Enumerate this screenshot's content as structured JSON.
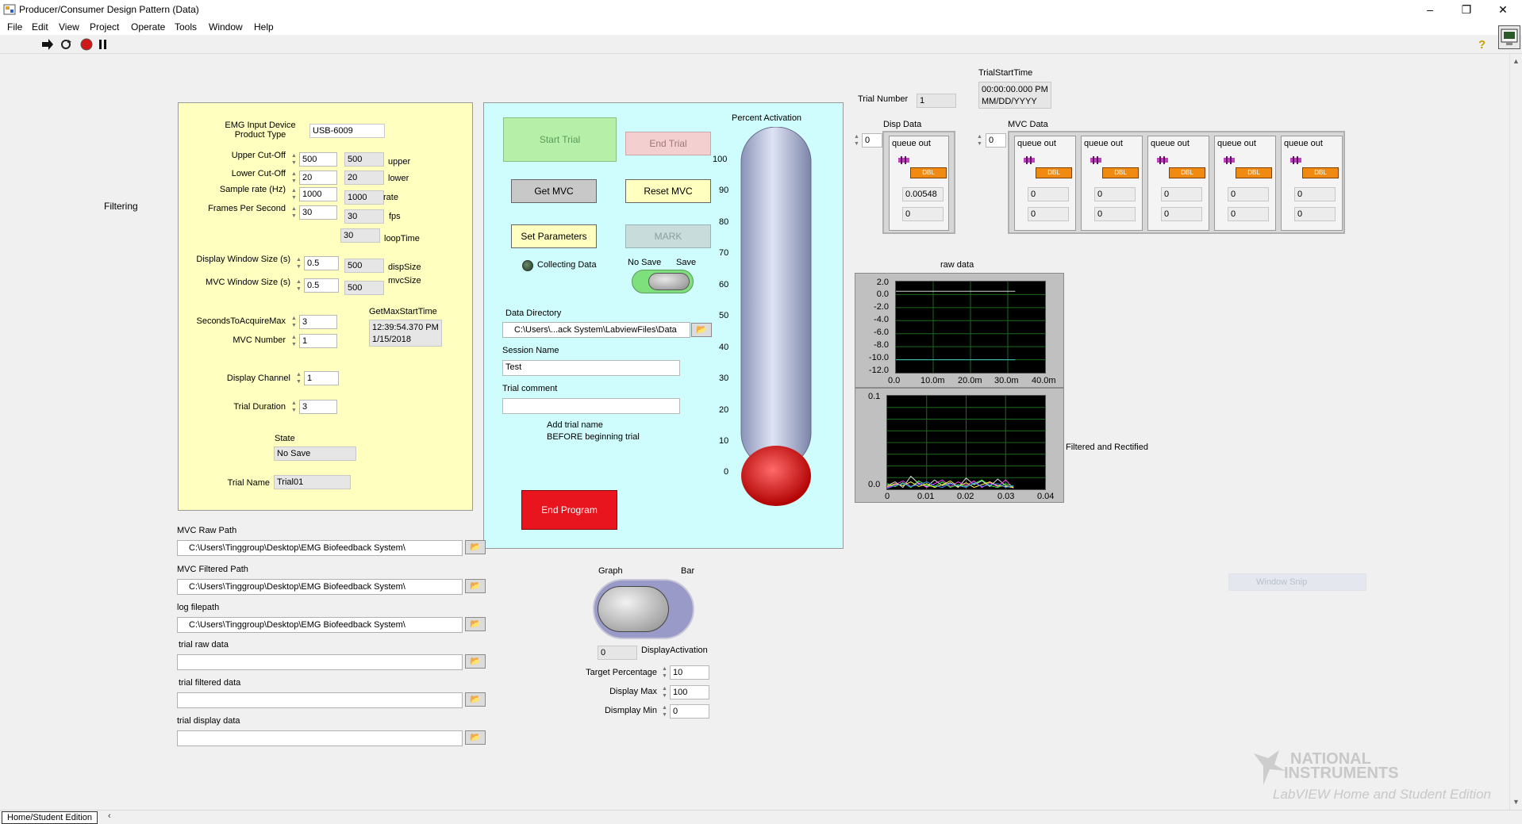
{
  "window": {
    "title": "Producer/Consumer Design Pattern (Data)",
    "minimize": "–",
    "restore": "❐",
    "close": "✕"
  },
  "menu": [
    "File",
    "Edit",
    "View",
    "Project",
    "Operate",
    "Tools",
    "Window",
    "Help"
  ],
  "side_label": "Filtering",
  "settings": {
    "emg_device_label": "EMG Input Device\nProduct Type",
    "emg_device_value": "USB-6009",
    "upper_label": "Upper Cut-Off",
    "upper_value": "500",
    "upper_ind": "500",
    "upper_unit": "upper",
    "lower_label": "Lower Cut-Off",
    "lower_value": "20",
    "lower_ind": "20",
    "lower_unit": "lower",
    "rate_label": "Sample rate (Hz)",
    "rate_value": "1000",
    "rate_ind": "1000",
    "rate_unit": "rate",
    "fps_label": "Frames Per Second",
    "fps_value": "30",
    "fps_ind": "30",
    "fps_unit": "fps",
    "loop_ind": "30",
    "loop_unit": "loopTime",
    "disp_label": "Display Window Size (s)",
    "disp_value": "0.5",
    "disp_ind": "500",
    "disp_unit": "dispSize",
    "mvcwin_label": "MVC Window Size (s)",
    "mvcwin_value": "0.5",
    "mvcwin_ind": "500",
    "mvcwin_unit": "mvcSize",
    "secs_label": "SecondsToAcquireMax",
    "secs_value": "3",
    "mvcnum_label": "MVC Number",
    "mvcnum_value": "1",
    "getmax_label": "GetMaxStartTime",
    "getmax_time": "12:39:54.370 PM",
    "getmax_date": "1/15/2018",
    "channel_label": "Display Channel",
    "channel_value": "1",
    "duration_label": "Trial Duration",
    "duration_value": "3",
    "state_label": "State",
    "state_value": "No Save",
    "trialname_label": "Trial Name",
    "trialname_value": "Trial01"
  },
  "control": {
    "start_trial": "Start Trial",
    "end_trial": "End Trial",
    "get_mvc": "Get MVC",
    "reset_mvc": "Reset MVC",
    "set_params": "Set Parameters",
    "mark": "MARK",
    "collecting": "Collecting Data",
    "no_save": "No Save",
    "save": "Save",
    "data_dir_label": "Data Directory",
    "data_dir_value": "C:\\Users\\...ack System\\LabviewFiles\\Data",
    "session_label": "Session Name",
    "session_value": "Test",
    "comment_label": "Trial comment",
    "comment_value": "",
    "hint_line1": "Add trial name",
    "hint_line2": "BEFORE beginning trial",
    "end_program": "End Program",
    "activation_label": "Percent Activation",
    "activation_ticks": [
      "100",
      "90",
      "80",
      "70",
      "60",
      "50",
      "40",
      "30",
      "20",
      "10",
      "0"
    ],
    "activation_value": 0
  },
  "paths": [
    {
      "label": "MVC Raw Path",
      "value": "C:\\Users\\Tinggroup\\Desktop\\EMG Biofeedback System\\"
    },
    {
      "label": "MVC Filtered Path",
      "value": "C:\\Users\\Tinggroup\\Desktop\\EMG Biofeedback System\\"
    },
    {
      "label": "log filepath",
      "value": "C:\\Users\\Tinggroup\\Desktop\\EMG Biofeedback System\\"
    },
    {
      "label": "trial raw data",
      "value": ""
    },
    {
      "label": "trial filtered data",
      "value": ""
    },
    {
      "label": "trial display data",
      "value": ""
    }
  ],
  "display_mode": {
    "graph": "Graph",
    "bar": "Bar",
    "activation_value": "0",
    "activation_label": "DisplayActivation",
    "target_label": "Target Percentage",
    "target_value": "10",
    "max_label": "Display Max",
    "max_value": "100",
    "min_label": "Dismplay Min",
    "min_value": "0"
  },
  "trial": {
    "number_label": "Trial Number",
    "number_value": "1",
    "start_label": "TrialStartTime",
    "start_time": "00:00:00.000 PM",
    "start_date": "MM/DD/YYYY"
  },
  "disp_data": {
    "label": "Disp Data",
    "index": "0",
    "queue_label": "queue out",
    "dbl": "DBL",
    "v1": "0.00548",
    "v2": "0"
  },
  "mvc_data": {
    "label": "MVC Data",
    "index": "0",
    "queues": [
      {
        "label": "queue out",
        "v1": "0",
        "v2": "0"
      },
      {
        "label": "queue out",
        "v1": "0",
        "v2": "0"
      },
      {
        "label": "queue out",
        "v1": "0",
        "v2": "0"
      },
      {
        "label": "queue out",
        "v1": "0",
        "v2": "0"
      },
      {
        "label": "queue out",
        "v1": "0",
        "v2": "0"
      }
    ]
  },
  "raw_chart": {
    "title": "raw data",
    "yticks": [
      "2.0",
      "0.0",
      "-2.0",
      "-4.0",
      "-6.0",
      "-8.0",
      "-10.0",
      "-12.0"
    ],
    "xticks": [
      "0.0",
      "10.0m",
      "20.0m",
      "30.0m",
      "40.0m"
    ]
  },
  "filtered_chart": {
    "title": "Filtered and Rectified",
    "yticks": [
      "0.1",
      "0.0"
    ],
    "xticks": [
      "0",
      "0.01",
      "0.02",
      "0.03",
      "0.04"
    ]
  },
  "chart_data": [
    {
      "type": "line",
      "title": "raw data",
      "xlim": [
        0,
        0.04
      ],
      "ylim": [
        -12,
        2
      ],
      "series": [
        {
          "color": "#d0d0d0",
          "x": [
            0,
            0.032
          ],
          "y": [
            0.5,
            0.5
          ]
        },
        {
          "color": "#40c8c8",
          "x": [
            0,
            0.032
          ],
          "y": [
            -10,
            -10
          ]
        }
      ]
    },
    {
      "type": "line",
      "title": "Filtered and Rectified",
      "xlim": [
        0,
        0.04
      ],
      "ylim": [
        0,
        0.1
      ],
      "series": [
        {
          "color": "#e0e0e0",
          "x": [
            0,
            0.002,
            0.004,
            0.006,
            0.008,
            0.01,
            0.012,
            0.014,
            0.016,
            0.018,
            0.02,
            0.022,
            0.024,
            0.026,
            0.028,
            0.03,
            0.032
          ],
          "y": [
            0.004,
            0.008,
            0.002,
            0.014,
            0.006,
            0.003,
            0.01,
            0.004,
            0.007,
            0.002,
            0.012,
            0.005,
            0.009,
            0.003,
            0.011,
            0.004,
            0.002
          ]
        },
        {
          "color": "#ff40ff",
          "x": [
            0,
            0.002,
            0.004,
            0.006,
            0.008,
            0.01,
            0.012,
            0.014,
            0.016,
            0.018,
            0.02,
            0.022,
            0.024,
            0.026,
            0.028,
            0.03,
            0.032
          ],
          "y": [
            0.002,
            0.005,
            0.009,
            0.003,
            0.007,
            0.002,
            0.006,
            0.01,
            0.003,
            0.008,
            0.004,
            0.009,
            0.002,
            0.007,
            0.003,
            0.01,
            0.001
          ]
        },
        {
          "color": "#40ff40",
          "x": [
            0,
            0.002,
            0.004,
            0.006,
            0.008,
            0.01,
            0.012,
            0.014,
            0.016,
            0.018,
            0.02,
            0.022,
            0.024,
            0.026,
            0.028,
            0.03,
            0.032
          ],
          "y": [
            0.006,
            0.003,
            0.007,
            0.002,
            0.009,
            0.004,
            0.003,
            0.008,
            0.002,
            0.005,
            0.003,
            0.006,
            0.01,
            0.004,
            0.002,
            0.006,
            0.003
          ]
        },
        {
          "color": "#ffff40",
          "x": [
            0,
            0.002,
            0.004,
            0.006,
            0.008,
            0.01,
            0.012,
            0.014,
            0.016,
            0.018,
            0.02,
            0.022,
            0.024,
            0.026,
            0.028,
            0.03,
            0.032
          ],
          "y": [
            0.003,
            0.006,
            0.004,
            0.008,
            0.003,
            0.006,
            0.002,
            0.005,
            0.009,
            0.003,
            0.007,
            0.002,
            0.005,
            0.008,
            0.004,
            0.003,
            0.002
          ]
        },
        {
          "color": "#4080ff",
          "x": [
            0,
            0.002,
            0.004,
            0.006,
            0.008,
            0.01,
            0.012,
            0.014,
            0.016,
            0.018,
            0.02,
            0.022,
            0.024,
            0.026,
            0.028,
            0.03,
            0.032
          ],
          "y": [
            0.001,
            0.004,
            0.006,
            0.003,
            0.005,
            0.008,
            0.004,
            0.002,
            0.006,
            0.004,
            0.002,
            0.007,
            0.003,
            0.005,
            0.006,
            0.002,
            0.004
          ]
        }
      ]
    }
  ],
  "status": {
    "edition": "Home/Student Edition",
    "window_snip": "Window Snip"
  },
  "watermark": {
    "line1": "NATIONAL",
    "line2": "INSTRUMENTS",
    "line3": "LabVIEW Home and Student Edition"
  },
  "colors": {
    "settings_panel": "#ffffc0",
    "control_panel": "#cffcfc",
    "start_trial": "#b6f0a8",
    "end_trial": "#f3cfcf",
    "end_program": "#e8141e",
    "thermo_fill": "#e00000",
    "chart_bg": "#000000",
    "grid": "#1e6a1e"
  }
}
